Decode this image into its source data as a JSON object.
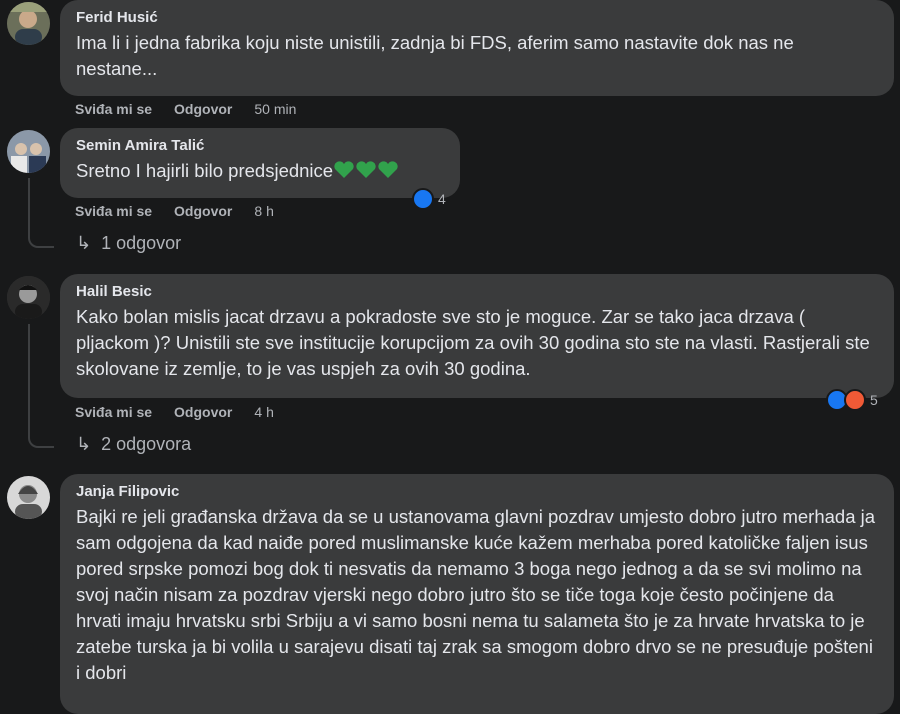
{
  "comments": [
    {
      "author": "Ferid Husić",
      "text": "Ima li i jedna fabrika koju niste unistili, zadnja bi FDS, aferim samo nastavite dok nas ne nestane...",
      "like_label": "Sviđa mi se",
      "reply_label": "Odgovor",
      "time": "50 min"
    },
    {
      "author": "Semin Amira Talić",
      "text": "Sretno I hajirli bilo predsjednice",
      "like_label": "Sviđa mi se",
      "reply_label": "Odgovor",
      "time": "8 h",
      "reaction_count": "4",
      "replies_label": "1 odgovor"
    },
    {
      "author": "Halil Besic",
      "text": "Kako bolan mislis jacat drzavu a pokradoste sve sto je moguce. Zar se tako jaca drzava ( pljackom )? Unistili ste sve institucije korupcijom za ovih 30 godina sto ste na vlasti. Rastjerali ste skolovane iz zemlje, to je vas uspjeh za ovih 30 godina.",
      "like_label": "Sviđa mi se",
      "reply_label": "Odgovor",
      "time": "4 h",
      "reaction_count": "5",
      "replies_label": "2 odgovora"
    },
    {
      "author": "Janja Filipovic",
      "text": "Bajki re jeli građanska država da se u ustanovama glavni pozdrav umjesto dobro jutro merhada ja sam odgojena da kad naiđe pored muslimanske kuće kažem merhaba pored katoličke faljen isus pored srpske pomozi bog dok ti nesvatis da nemamo 3 boga nego jednog a da se svi molimo na svoj način nisam za pozdrav vjerski nego dobro jutro što se tiče toga koje često počinjene da hrvati imaju hrvatsku srbi Srbiju a vi samo bosni nema tu salameta što je za hrvate hrvatska to je zatebe turska ja bi volila u sarajevu disati taj zrak sa smogom dobro drvo se ne presuđuje pošteni i dobri"
    }
  ],
  "colors": {
    "background": "#18191a",
    "bubble": "#3a3b3c",
    "primary_text": "#e4e6eb",
    "secondary_text": "#b0b3b8",
    "like_blue": "#1877f2",
    "angry_orange": "#f05a36",
    "heart_green": "#31a24c"
  }
}
